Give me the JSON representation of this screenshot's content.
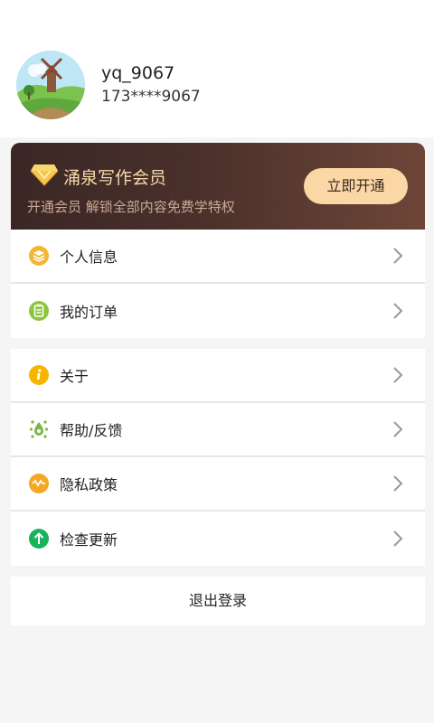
{
  "profile": {
    "username": "yq_9067",
    "phone": "173****9067",
    "avatar_icon": "windmill-landscape-avatar"
  },
  "vip": {
    "title": "涌泉写作会员",
    "subtitle": "开通会员 解锁全部内容免费学特权",
    "button_label": "立即开通",
    "icon": "diamond-icon",
    "accent_color": "#fbd7a6"
  },
  "menu_group_1": [
    {
      "label": "个人信息",
      "icon": "stack-icon",
      "color": "#f2b631"
    },
    {
      "label": "我的订单",
      "icon": "clipboard-icon",
      "color": "#8cc63f"
    }
  ],
  "menu_group_2": [
    {
      "label": "关于",
      "icon": "info-icon",
      "color": "#f7b500"
    },
    {
      "label": "帮助/反馈",
      "icon": "feedback-icon",
      "color": "#7ab648"
    },
    {
      "label": "隐私政策",
      "icon": "privacy-icon",
      "color": "#f5a623"
    },
    {
      "label": "检查更新",
      "icon": "update-arrow-icon",
      "color": "#17b35a"
    }
  ],
  "logout_label": "退出登录"
}
